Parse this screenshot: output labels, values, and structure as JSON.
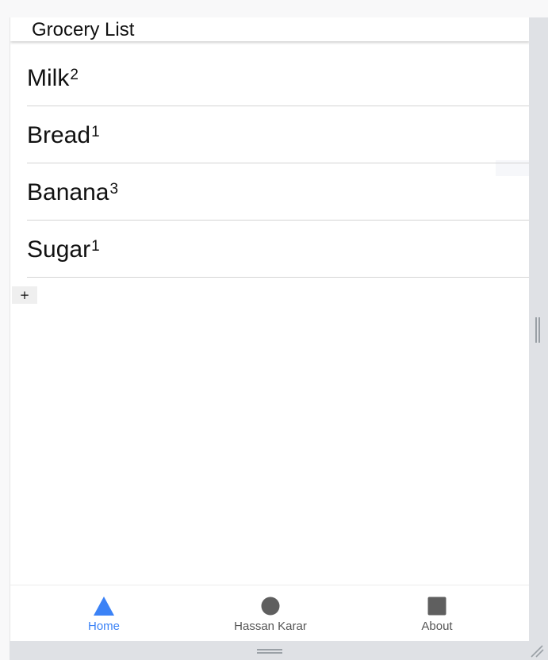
{
  "header": {
    "title": "Grocery List"
  },
  "list": {
    "items": [
      {
        "name": "Milk",
        "quantity": "2"
      },
      {
        "name": "Bread",
        "quantity": "1"
      },
      {
        "name": "Banana",
        "quantity": "3"
      },
      {
        "name": "Sugar",
        "quantity": "1"
      }
    ],
    "add_label": "+"
  },
  "tabs": [
    {
      "label": "Home",
      "icon": "triangle-icon",
      "active": true,
      "color": "#3b82f6"
    },
    {
      "label": "Hassan Karar",
      "icon": "circle-icon",
      "active": false,
      "color": "#555555"
    },
    {
      "label": "About",
      "icon": "square-icon",
      "active": false,
      "color": "#555555"
    }
  ],
  "colors": {
    "accent": "#3b82f6",
    "inactive": "#555555",
    "divider": "#d4d4d4"
  }
}
